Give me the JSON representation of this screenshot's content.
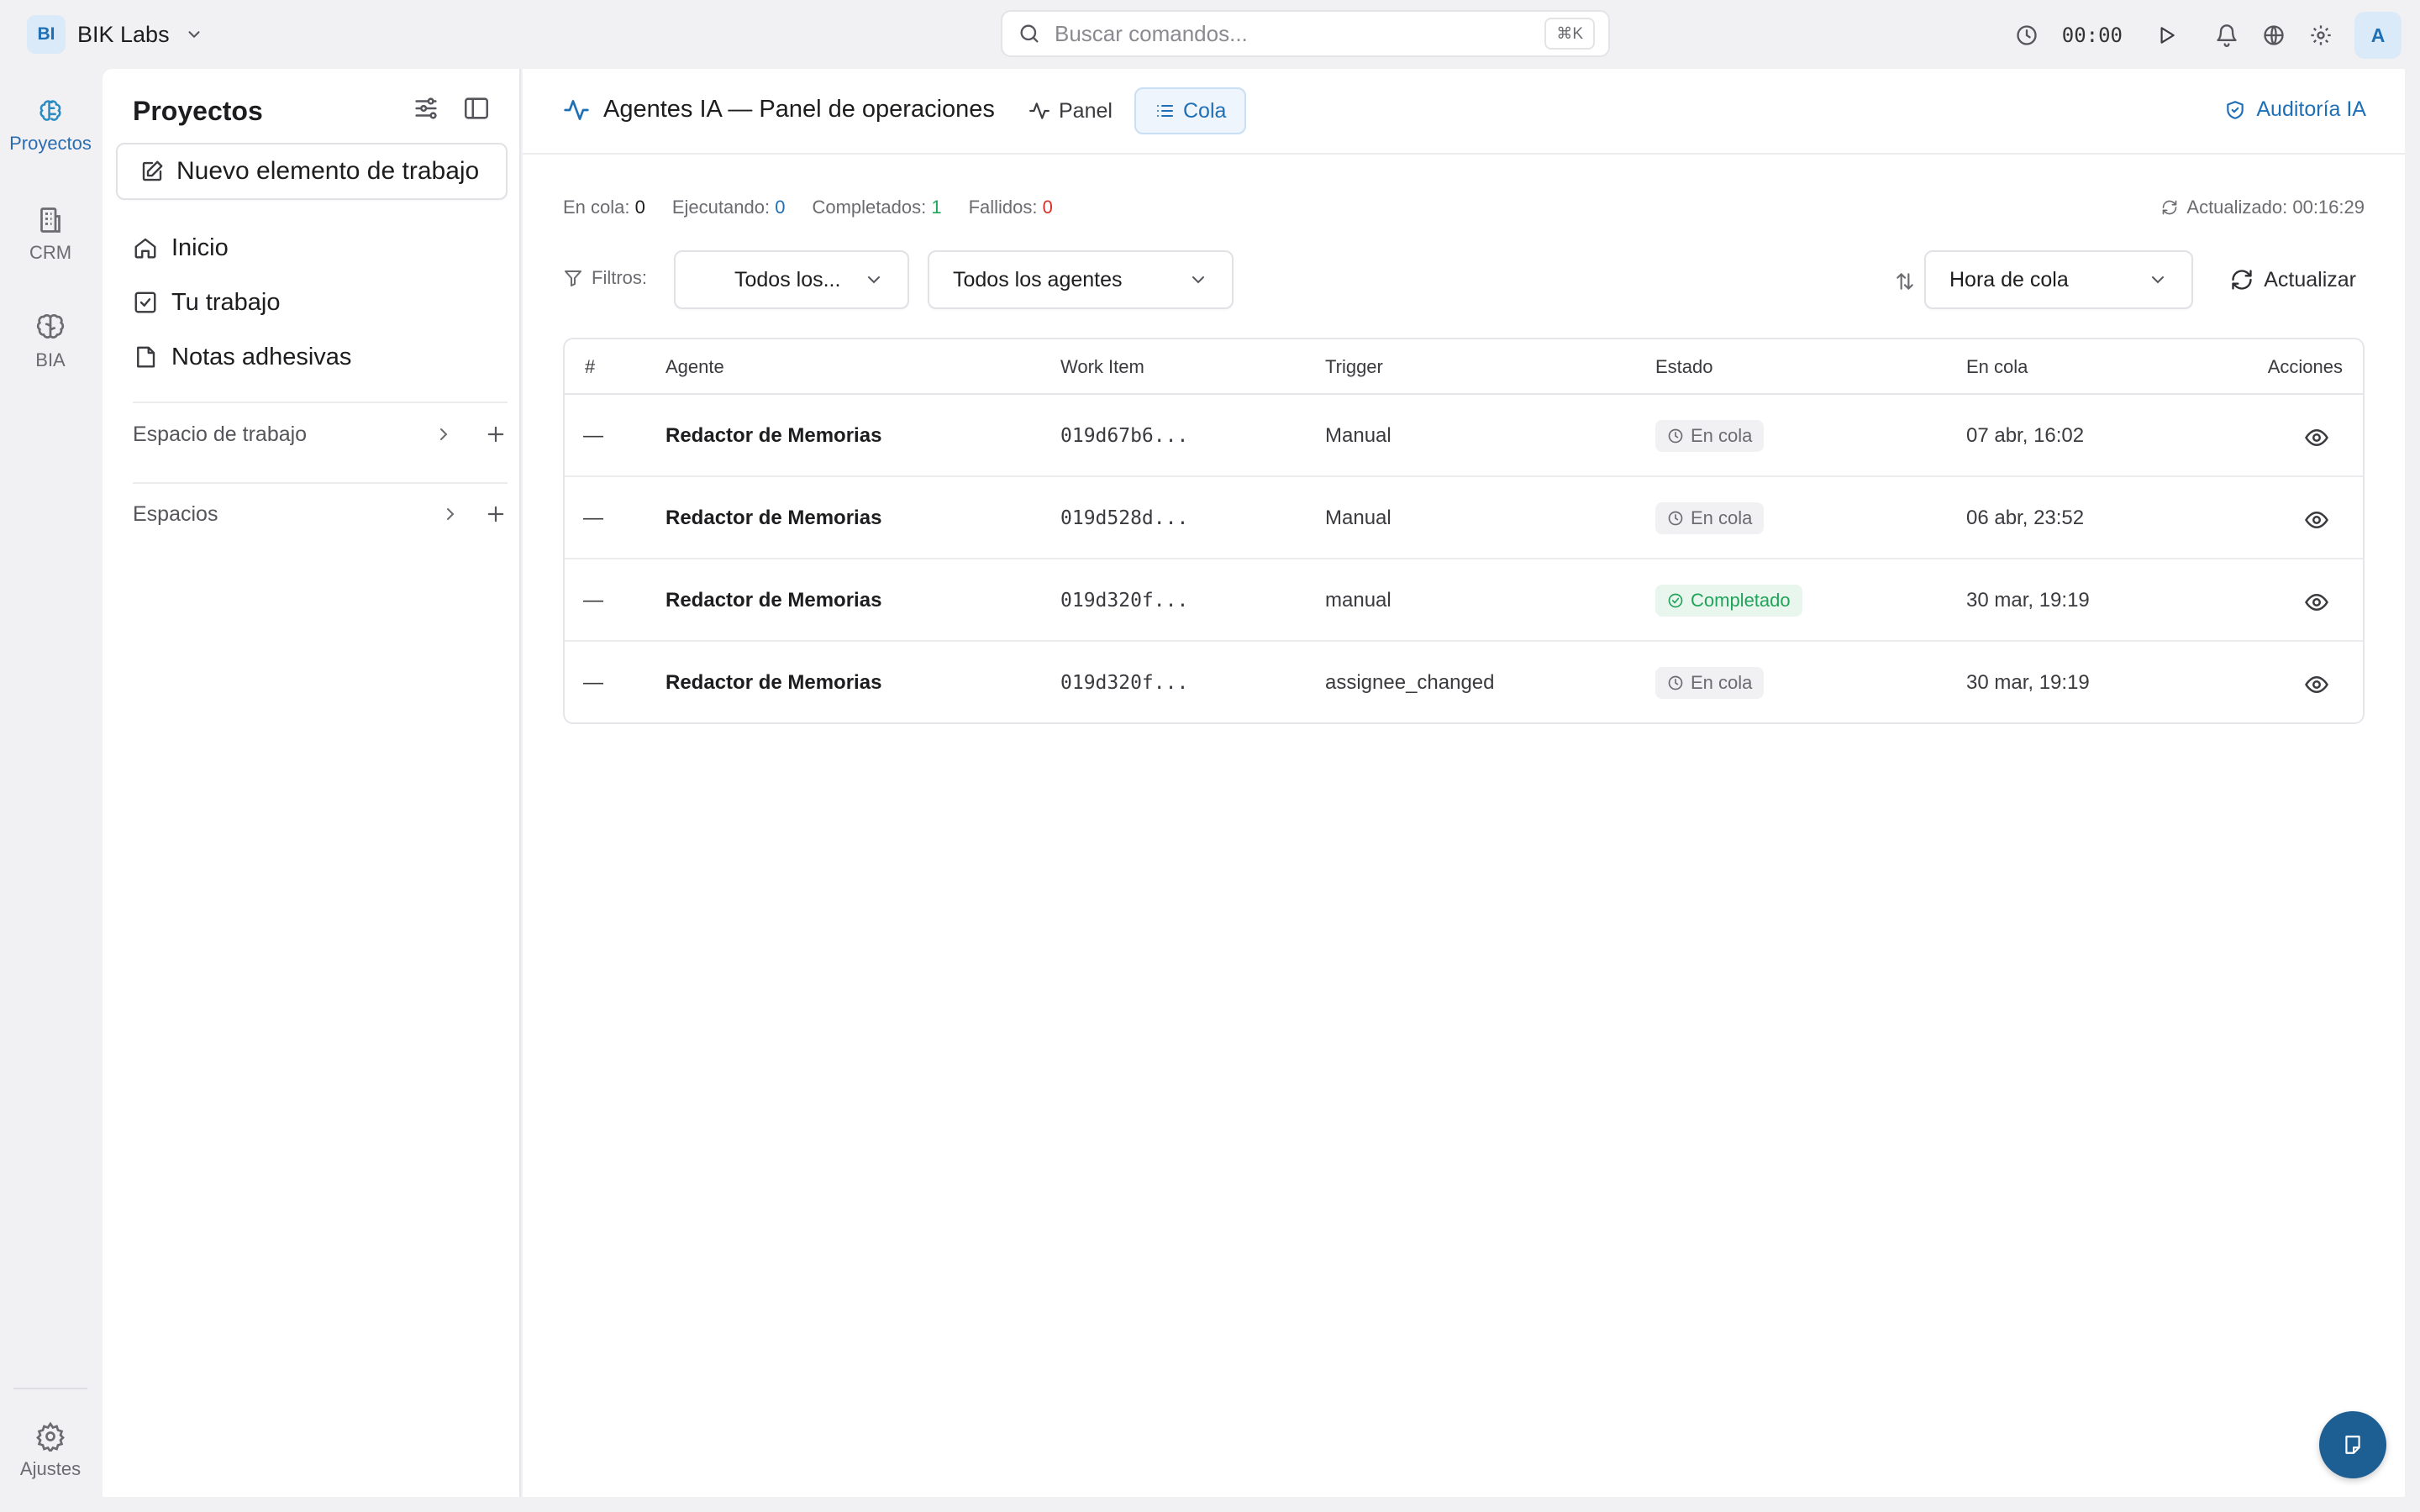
{
  "workspace": {
    "badge": "BI",
    "name": "BIK Labs"
  },
  "search": {
    "placeholder": "Buscar comandos...",
    "shortcut": "⌘K"
  },
  "topbar": {
    "timer": "00:00",
    "avatar": "A"
  },
  "rail": {
    "items": [
      {
        "label": "Proyectos",
        "icon": "brain-circuit-icon",
        "active": true
      },
      {
        "label": "CRM",
        "icon": "building-icon",
        "active": false
      },
      {
        "label": "BIA",
        "icon": "brain-icon",
        "active": false
      }
    ],
    "settings_label": "Ajustes"
  },
  "sidebar": {
    "title": "Proyectos",
    "new_item_label": "Nuevo elemento de trabajo",
    "nav": [
      {
        "label": "Inicio",
        "icon": "home-icon"
      },
      {
        "label": "Tu trabajo",
        "icon": "checkbox-icon"
      },
      {
        "label": "Notas adhesivas",
        "icon": "sticky-note-icon"
      }
    ],
    "sections": [
      {
        "label": "Espacio de trabajo"
      },
      {
        "label": "Espacios"
      }
    ]
  },
  "main": {
    "title": "Agentes IA — Panel de operaciones",
    "tabs": [
      {
        "label": "Panel",
        "active": false
      },
      {
        "label": "Cola",
        "active": true
      }
    ],
    "audit_label": "Auditoría IA",
    "stats": {
      "queued_label": "En cola:",
      "queued": "0",
      "running_label": "Ejecutando:",
      "running": "0",
      "completed_label": "Completados:",
      "completed": "1",
      "failed_label": "Fallidos:",
      "failed": "0"
    },
    "updated": "Actualizado: 00:16:29",
    "filters": {
      "label": "Filtros:",
      "status_value": "Todos los...",
      "agent_value": "Todos los agentes",
      "sort_value": "Hora de cola",
      "refresh_label": "Actualizar"
    },
    "table": {
      "headers": [
        "#",
        "Agente",
        "Work Item",
        "Trigger",
        "Estado",
        "En cola",
        "Acciones"
      ],
      "rows": [
        {
          "num": "—",
          "agent": "Redactor de Memorias",
          "work_item": "019d67b6...",
          "trigger": "Manual",
          "status": "En cola",
          "status_kind": "queued",
          "queued_at": "07 abr, 16:02"
        },
        {
          "num": "—",
          "agent": "Redactor de Memorias",
          "work_item": "019d528d...",
          "trigger": "Manual",
          "status": "En cola",
          "status_kind": "queued",
          "queued_at": "06 abr, 23:52"
        },
        {
          "num": "—",
          "agent": "Redactor de Memorias",
          "work_item": "019d320f...",
          "trigger": "manual",
          "status": "Completado",
          "status_kind": "done",
          "queued_at": "30 mar, 19:19"
        },
        {
          "num": "—",
          "agent": "Redactor de Memorias",
          "work_item": "019d320f...",
          "trigger": "assignee_changed",
          "status": "En cola",
          "status_kind": "queued",
          "queued_at": "30 mar, 19:19"
        }
      ]
    }
  },
  "colors": {
    "accent": "#1f6fb5",
    "success": "#21a35a",
    "danger": "#d93025",
    "fab": "#1d5e93"
  }
}
